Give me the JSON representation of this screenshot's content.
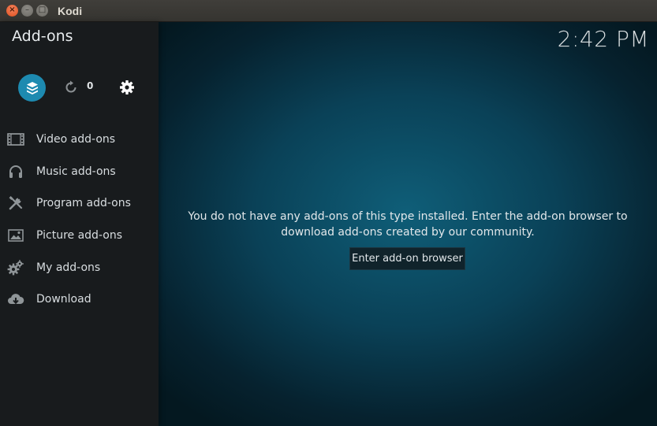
{
  "window": {
    "title": "Kodi",
    "close_glyph": "×",
    "min_glyph": "–",
    "max_glyph": "□"
  },
  "header": {
    "page_title": "Add-ons",
    "clock": "2:42 PM"
  },
  "toolbar": {
    "update_count": "0"
  },
  "menu": {
    "items": [
      {
        "label": "Video add-ons",
        "icon": "film-icon"
      },
      {
        "label": "Music add-ons",
        "icon": "headphones-icon"
      },
      {
        "label": "Program add-ons",
        "icon": "tools-icon"
      },
      {
        "label": "Picture add-ons",
        "icon": "picture-icon"
      },
      {
        "label": "My add-ons",
        "icon": "gears-icon"
      },
      {
        "label": "Download",
        "icon": "cloud-download-icon"
      }
    ]
  },
  "main": {
    "message_line1": "You do not have any add-ons of this type installed. Enter the add-on browser to",
    "message_line2": "download add-ons created by our community.",
    "browse_button": "Enter add-on browser"
  },
  "colors": {
    "accent": "#1d8ab0",
    "sidebar": "#181b1d",
    "background": "#0a4157"
  }
}
